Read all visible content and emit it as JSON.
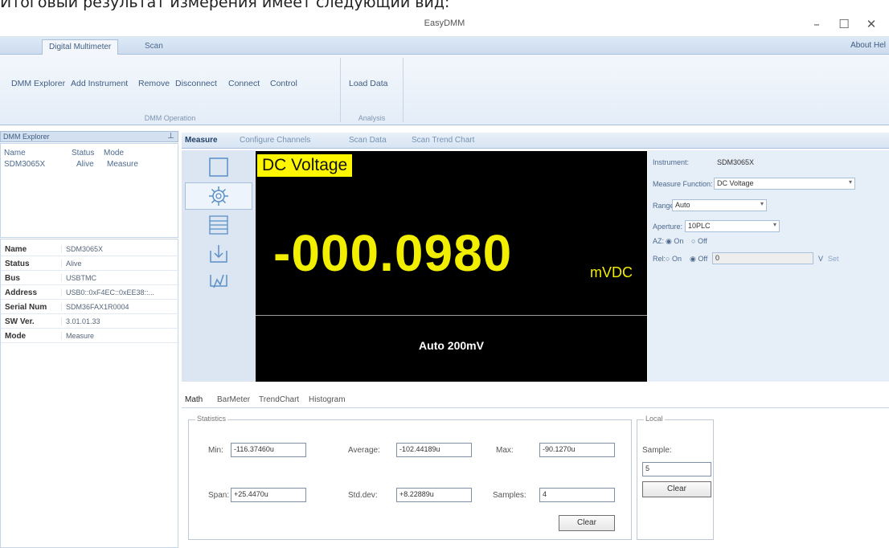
{
  "caption": "Итоговый результат измерения имеет следующий вид:",
  "window": {
    "title": "EasyDMM",
    "minimize": "–",
    "maximize": "☐",
    "close": "✕"
  },
  "ribbon": {
    "tabs": [
      "Digital Multimeter",
      "Scan"
    ],
    "about": "About  Hel",
    "groups": [
      {
        "buttons": [
          "DMM Explorer",
          "Add Instrument",
          "Remove",
          "Disconnect",
          "Connect",
          "Control"
        ],
        "label": "DMM Operation"
      },
      {
        "buttons": [
          "Load Data"
        ],
        "label": "Analysis"
      }
    ]
  },
  "explorer": {
    "title": "DMM Explorer",
    "headers": [
      "Name",
      "Status",
      "Mode"
    ],
    "row": [
      "SDM3065X",
      "Alive",
      "Measure"
    ]
  },
  "properties": [
    {
      "key": "Name",
      "value": "SDM3065X"
    },
    {
      "key": "Status",
      "value": "Alive"
    },
    {
      "key": "Bus",
      "value": "USBTMC"
    },
    {
      "key": "Address",
      "value": "USB0::0xF4EC::0xEE38::..."
    },
    {
      "key": "Serial Num",
      "value": "SDM36FAX1R0004"
    },
    {
      "key": "SW Ver.",
      "value": "3.01.01.33"
    },
    {
      "key": "Mode",
      "value": "Measure"
    }
  ],
  "main_tabs": [
    "Measure",
    "Configure Channels",
    "Scan Data",
    "Scan Trend Chart"
  ],
  "display": {
    "function": "DC Voltage",
    "reading": "-000.0980",
    "unit": "mVDC",
    "range": "Auto 200mV"
  },
  "settings": {
    "instrument_label": "Instrument:",
    "instrument_value": "SDM3065X",
    "measure_function_label": "Measure Function:",
    "measure_function_value": "DC Voltage",
    "range_label": "Range:",
    "range_value": "Auto",
    "aperture_label": "Aperture:",
    "aperture_value": "10PLC",
    "az_label": "AZ:",
    "az_on": "On",
    "az_off": "Off",
    "rel_label": "Rel:",
    "rel_on": "On",
    "rel_off": "Off",
    "rel_value": "0",
    "rel_unit": "V",
    "rel_link": "Set"
  },
  "stats_tabs": [
    "Math",
    "BarMeter",
    "TrendChart",
    "Histogram"
  ],
  "statistics": {
    "title": "Statistics",
    "min_label": "Min:",
    "min_value": "-116.37460u",
    "average_label": "Average:",
    "average_value": "-102.44189u",
    "max_label": "Max:",
    "max_value": "-90.1270u",
    "span_label": "Span:",
    "span_value": "+25.4470u",
    "stddev_label": "Std.dev:",
    "stddev_value": "+8.22889u",
    "samples_label": "Samples:",
    "samples_value": "4",
    "clear": "Clear"
  },
  "local": {
    "title": "Local",
    "sample_label": "Sample:",
    "sample_value": "5",
    "clear": "Clear"
  },
  "colors": {
    "display_bg": "#000000",
    "reading": "#f2ee00",
    "function_badge": "#fff700",
    "ribbon": "#dde9f6"
  }
}
